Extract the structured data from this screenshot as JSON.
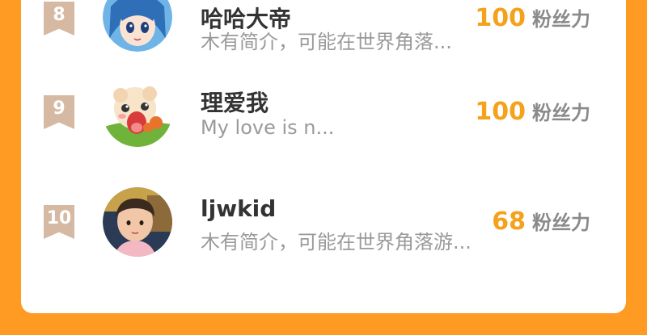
{
  "fan_unit": "粉丝力",
  "rows": [
    {
      "rank": "8",
      "name": "哈哈大帝",
      "desc": "木有简介，可能在世界角落...",
      "fans": "100",
      "avatar": "anime-girl-avatar"
    },
    {
      "rank": "9",
      "name": "理爱我",
      "desc": "My love is n...",
      "fans": "100",
      "avatar": "cartoon-sheep-avatar"
    },
    {
      "rank": "10",
      "name": "ljwkid",
      "desc": "木有简介，可能在世界角落游...",
      "fans": "68",
      "avatar": "child-photo-avatar"
    }
  ],
  "colors": {
    "background": "#FF9A23",
    "accent": "#F5A11B",
    "rank_badge": "#D5B9A2"
  }
}
